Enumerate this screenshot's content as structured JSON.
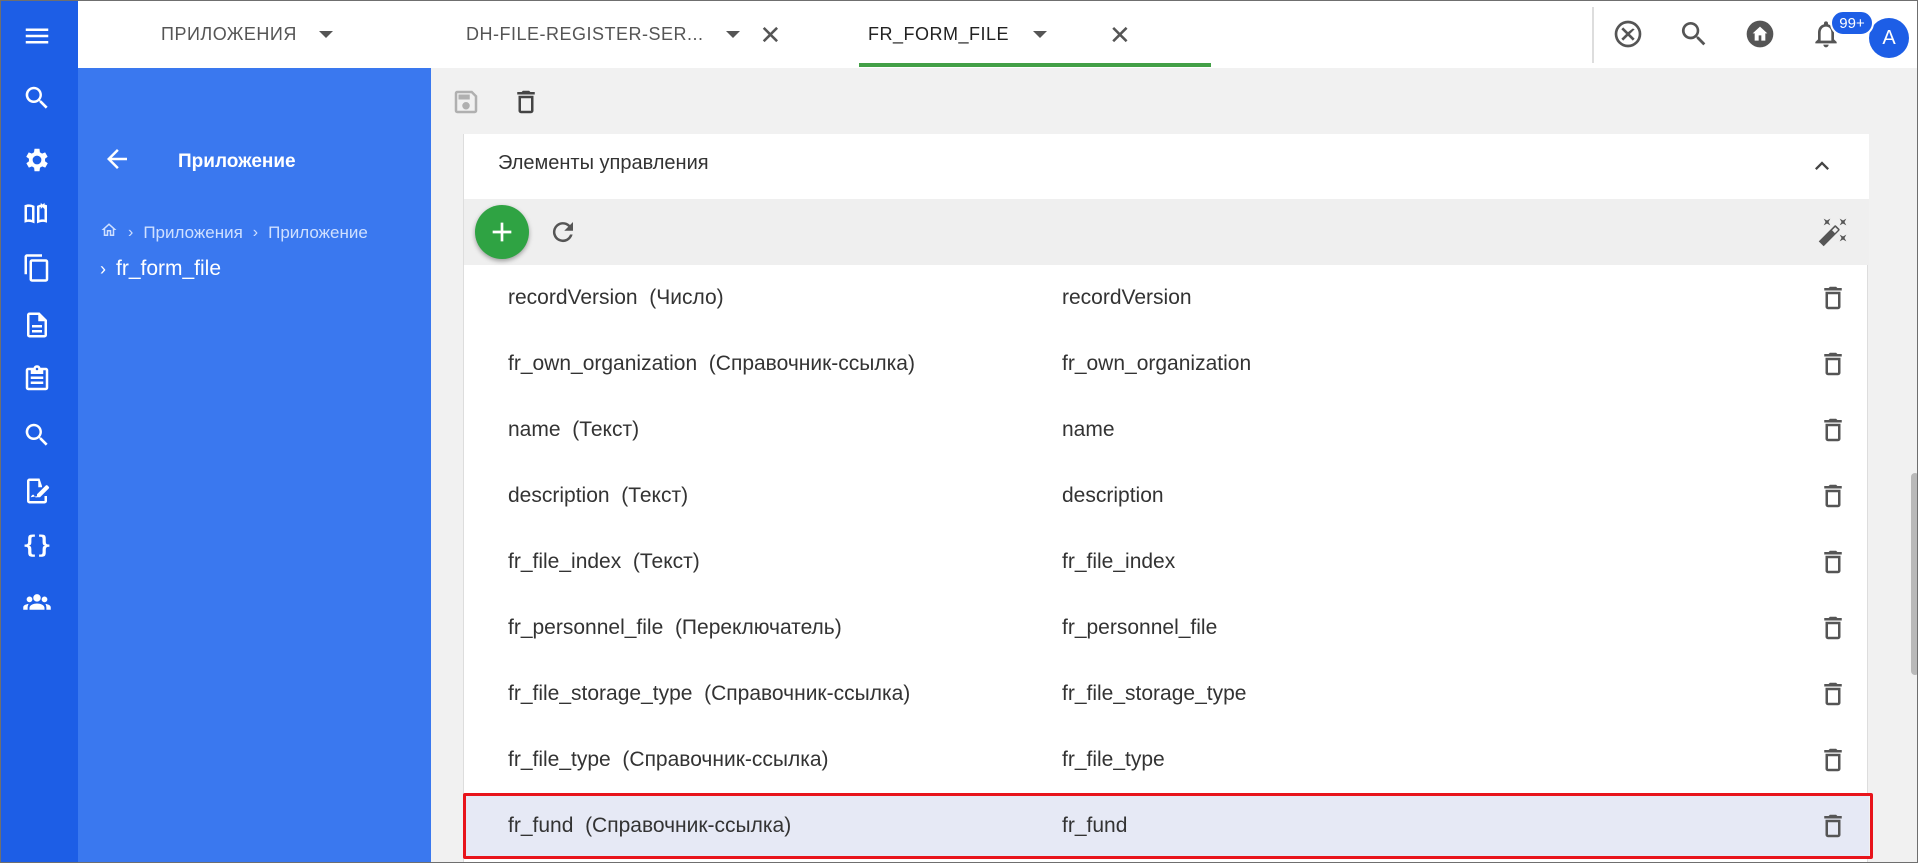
{
  "rail": {
    "items": [
      "menu-icon",
      "search-icon",
      "gear-icon",
      "book-icon",
      "copy-icon",
      "document-icon",
      "clipboard-icon",
      "search-icon",
      "signature-icon",
      "braces-icon",
      "people-icon"
    ],
    "braces": "{}"
  },
  "side": {
    "title": "Приложение",
    "breadcrumb": [
      "Приложения",
      "Приложение"
    ],
    "tree_item": "fr_form_file"
  },
  "tabs": [
    {
      "label": "ПРИЛОЖЕНИЯ"
    },
    {
      "label": "DH-FILE-REGISTER-SER..."
    },
    {
      "label": "FR_FORM_FILE"
    }
  ],
  "notifications": {
    "count": "99+"
  },
  "user": {
    "initial": "A"
  },
  "panel": {
    "title": "Элементы управления"
  },
  "rows": [
    {
      "name": "recordVersion",
      "type": "(Число)",
      "code": "recordVersion"
    },
    {
      "name": "fr_own_organization",
      "type": "(Справочник-ссылка)",
      "code": "fr_own_organization"
    },
    {
      "name": "name",
      "type": "(Текст)",
      "code": "name"
    },
    {
      "name": "description",
      "type": "(Текст)",
      "code": "description"
    },
    {
      "name": "fr_file_index",
      "type": "(Текст)",
      "code": "fr_file_index"
    },
    {
      "name": "fr_personnel_file",
      "type": "(Переключатель)",
      "code": "fr_personnel_file"
    },
    {
      "name": "fr_file_storage_type",
      "type": "(Справочник-ссылка)",
      "code": "fr_file_storage_type"
    },
    {
      "name": "fr_file_type",
      "type": "(Справочник-ссылка)",
      "code": "fr_file_type"
    },
    {
      "name": "fr_fund",
      "type": "(Справочник-ссылка)",
      "code": "fr_fund",
      "selected": true
    }
  ],
  "colors": {
    "rail": "#1d5ee6",
    "side": "#3a78ef",
    "accent": "#43a047",
    "fab": "#2fa343",
    "highlight": "#e8141b"
  }
}
